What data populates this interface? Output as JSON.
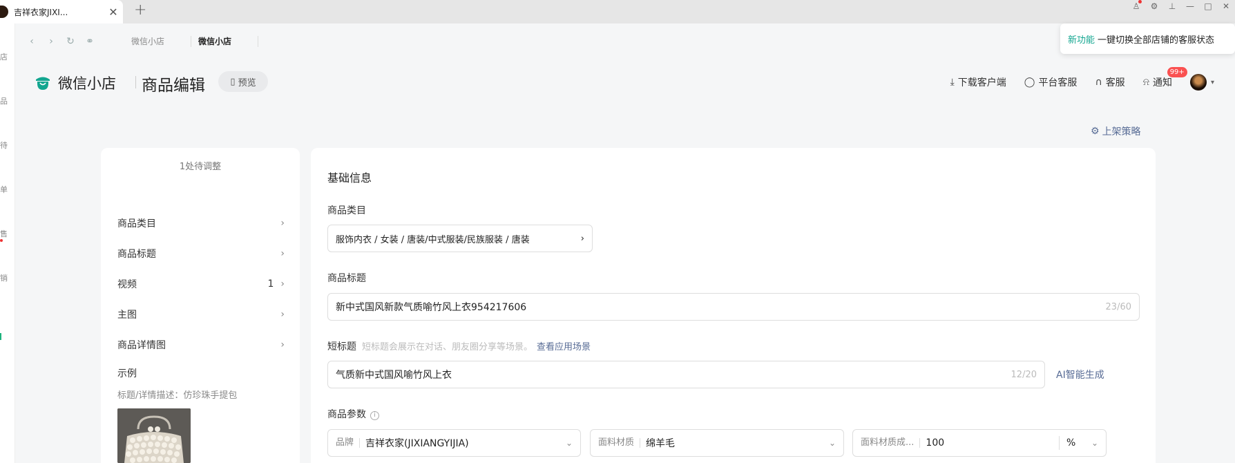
{
  "browser": {
    "tab_title": "吉祥衣家JIXI...",
    "close_symbol": "✕",
    "new_tab_symbol": "+"
  },
  "navbar": {
    "tabs": [
      "微信小店",
      "微信小店"
    ],
    "active_tab_index": 1
  },
  "notice": {
    "tag": "新功能",
    "text": "一键切换全部店铺的客服状态"
  },
  "header": {
    "logo_text": "微信小店",
    "page_title": "商品编辑",
    "preview_label": "预览",
    "actions": [
      {
        "label": "下载客户端",
        "icon": "download-icon"
      },
      {
        "label": "平台客服",
        "icon": "chat-icon"
      },
      {
        "label": "客服",
        "icon": "headset-icon"
      },
      {
        "label": "通知",
        "icon": "bell-icon",
        "badge": "99+"
      }
    ]
  },
  "strategy_link": "上架策略",
  "left_nav": {
    "pending": "1处待调整",
    "items": [
      {
        "label": "商品类目",
        "count": ""
      },
      {
        "label": "商品标题",
        "count": ""
      },
      {
        "label": "视频",
        "count": "1"
      },
      {
        "label": "主图",
        "count": ""
      },
      {
        "label": "商品详情图",
        "count": ""
      }
    ],
    "example_title": "示例",
    "example_desc": "标题/详情描述：仿珍珠手提包"
  },
  "form": {
    "section_title": "基础信息",
    "category": {
      "label": "商品类目",
      "value": "服饰内衣 / 女装 / 唐装/中式服装/民族服装 / 唐装"
    },
    "title": {
      "label": "商品标题",
      "value": "新中式国风新款气质喻竹风上衣954217606",
      "counter": "23/60"
    },
    "short_title": {
      "label": "短标题",
      "hint": "短标题会展示在对话、朋友圈分享等场景。",
      "hint_link": "查看应用场景",
      "value": "气质新中式国风喻竹风上衣",
      "counter": "12/20",
      "ai_label": "AI智能生成"
    },
    "params": {
      "label": "商品参数",
      "fields": [
        {
          "label": "品牌",
          "value": "吉祥衣家(JIXIANGYIJIA)"
        },
        {
          "label": "面料材质",
          "value": "绵羊毛"
        },
        {
          "label": "面料材质成...",
          "value": "100",
          "unit": "%"
        }
      ]
    }
  },
  "colors": {
    "accent_green": "#13a690",
    "link_blue": "#576b95",
    "badge_red": "#fa5151"
  }
}
